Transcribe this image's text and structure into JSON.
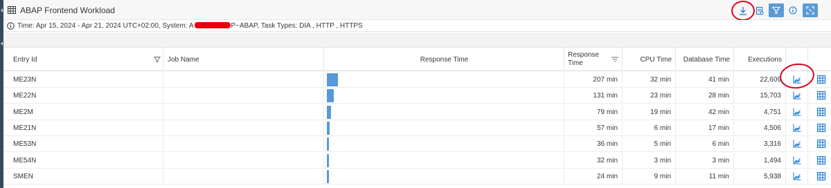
{
  "header": {
    "title": "ABAP Frontend Workload",
    "toolbar": {
      "download_icon": "download-icon",
      "export_icon": "export-report-icon",
      "filter_icon": "filter-icon",
      "info_icon": "info-icon",
      "fullscreen_icon": "fullscreen-icon"
    }
  },
  "info": {
    "text_before": "Time: Apr 15, 2024 - Apr 21, 2024 UTC+02:00, System: A",
    "text_after": "P~ABAP, Task Types: DIA , HTTP , HTTPS"
  },
  "columns": {
    "entry_id": "Entry Id",
    "job_name": "Job Name",
    "response_time_bar": "Response Time",
    "response_time_line1": "Response",
    "response_time_line2": "Time",
    "cpu_time": "CPU Time",
    "db_time": "Database Time",
    "executions": "Executions"
  },
  "rows": [
    {
      "entry_id": "ME23N",
      "job_name": "",
      "response_minutes": 207,
      "response": "207 min",
      "cpu": "32 min",
      "db": "41 min",
      "executions": "22,609"
    },
    {
      "entry_id": "ME22N",
      "job_name": "",
      "response_minutes": 131,
      "response": "131 min",
      "cpu": "23 min",
      "db": "28 min",
      "executions": "15,703"
    },
    {
      "entry_id": "ME2M",
      "job_name": "",
      "response_minutes": 79,
      "response": "79 min",
      "cpu": "19 min",
      "db": "42 min",
      "executions": "4,751"
    },
    {
      "entry_id": "ME21N",
      "job_name": "",
      "response_minutes": 57,
      "response": "57 min",
      "cpu": "6 min",
      "db": "17 min",
      "executions": "4,506"
    },
    {
      "entry_id": "ME53N",
      "job_name": "",
      "response_minutes": 36,
      "response": "36 min",
      "cpu": "5 min",
      "db": "6 min",
      "executions": "3,316"
    },
    {
      "entry_id": "ME54N",
      "job_name": "",
      "response_minutes": 32,
      "response": "32 min",
      "cpu": "3 min",
      "db": "3 min",
      "executions": "1,494"
    },
    {
      "entry_id": "SMEN",
      "job_name": "",
      "response_minutes": 24,
      "response": "24 min",
      "cpu": "9 min",
      "db": "11 min",
      "executions": "5,938"
    }
  ],
  "colors": {
    "bar": "#5899da",
    "accent": "#5b9bd5",
    "annotation": "#e0001a"
  }
}
